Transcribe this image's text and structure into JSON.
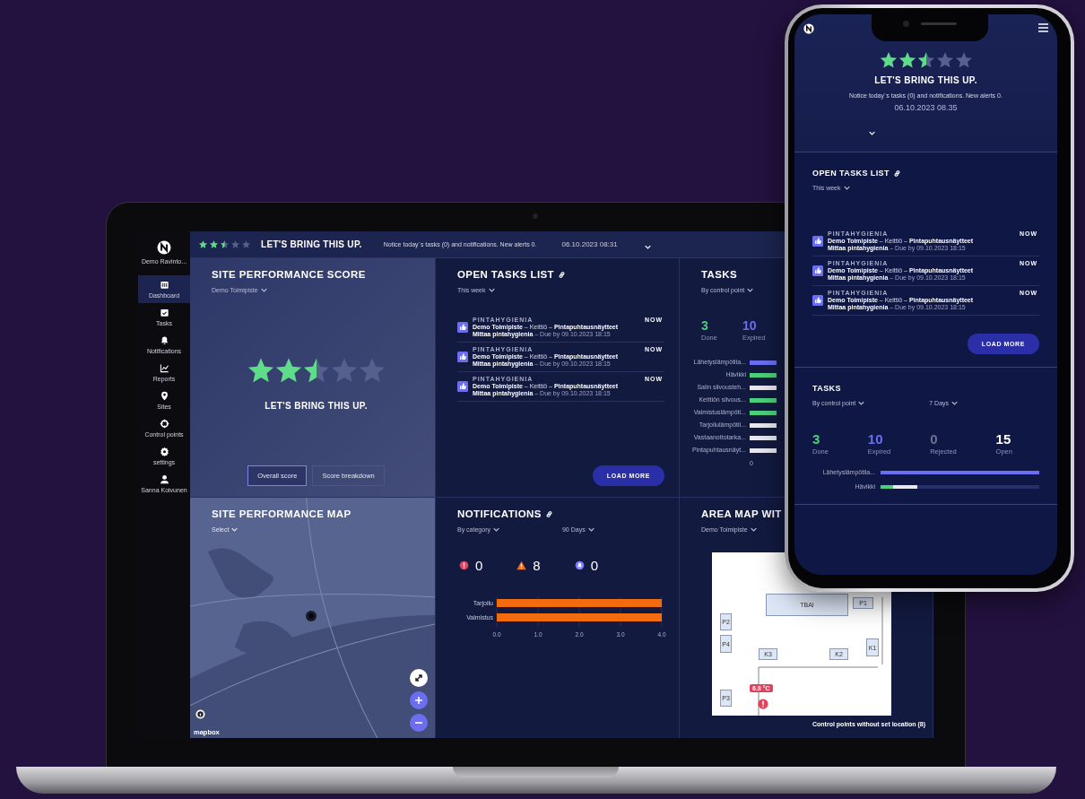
{
  "laptop": {
    "sidebar": {
      "org": "Demo Ravinto...",
      "items": [
        {
          "label": "Dashboard",
          "kind": "calendar",
          "selected": true
        },
        {
          "label": "Tasks",
          "kind": "checklist",
          "selected": false
        },
        {
          "label": "Notifications",
          "kind": "bell",
          "selected": false
        },
        {
          "label": "Reports",
          "kind": "chart",
          "selected": false
        },
        {
          "label": "Sites",
          "kind": "pin",
          "selected": false
        },
        {
          "label": "Control points",
          "kind": "target",
          "selected": false
        },
        {
          "label": "settings",
          "kind": "gear",
          "selected": false
        },
        {
          "label": "Sanna Koivunen",
          "kind": "user",
          "selected": false
        }
      ]
    },
    "top_bar": {
      "stars": 2.5,
      "headline": "LET'S BRING THIS UP.",
      "notice": "Notice today´s tasks (0) and notifications. New alerts 0.",
      "datetime": "06.10.2023 08:31"
    },
    "score_panel": {
      "title": "SITE PERFORMANCE SCORE",
      "filter": "Demo Toimipiste",
      "stars": 2.5,
      "headline": "LET'S BRING THIS UP.",
      "buttons": [
        {
          "label": "Overall score",
          "selected": true
        },
        {
          "label": "Score breakdown",
          "selected": false
        }
      ]
    },
    "open_tasks": {
      "title": "OPEN TASKS LIST",
      "filter": "This week",
      "items": [
        {
          "category": "PINTAHYGIENIA",
          "title": "**Demo Toimipiste** – Keittiö – **Pintapuhtausnäytteet**",
          "due": "**Mittaa pintahygienia** – Due by 09.10.2023 18:15",
          "badge": "NOW"
        },
        {
          "category": "PINTAHYGIENIA",
          "title": "**Demo Toimipiste** – Keittiö – **Pintapuhtausnäytteet**",
          "due": "**Mittaa pintahygienia** – Due by 09.10.2023 18:15",
          "badge": "NOW"
        },
        {
          "category": "PINTAHYGIENIA",
          "title": "**Demo Toimipiste** – Keittiö – **Pintapuhtausnäytteet**",
          "due": "**Mittaa pintahygienia** – Due by 09.10.2023 18:15",
          "badge": "NOW"
        }
      ],
      "load_more": "LOAD MORE"
    },
    "tasks": {
      "title": "TASKS",
      "filter": "By control point",
      "stats": [
        {
          "value": "3",
          "label": "Done",
          "color": "#4cd07d"
        },
        {
          "value": "10",
          "label": "Expired",
          "color": "#6b6ef0"
        }
      ],
      "bars": [
        {
          "label": "Lähetyslämpötila...",
          "color": "#6b6ef0"
        },
        {
          "label": "Hävikki",
          "color": "#4cd07d"
        },
        {
          "label": "Salin siivousteh...",
          "color": "#e8e8f2"
        },
        {
          "label": "Keittiön siivous...",
          "color": "#4cd07d"
        },
        {
          "label": "Valmistuslämpöti...",
          "color": "#4cd07d"
        },
        {
          "label": "Tarjoilulämpötil...",
          "color": "#e8e8f2"
        },
        {
          "label": "Vastaanottotarka...",
          "color": "#e8e8f2"
        },
        {
          "label": "Pintapuhtausnäyt...",
          "color": "#e8e8f2"
        }
      ],
      "axis_tick": "0"
    },
    "map_panel": {
      "title": "SITE PERFORMANCE MAP",
      "filter": "Select",
      "attribution": "mapbox"
    },
    "notifications": {
      "title": "NOTIFICATIONS",
      "filters": [
        "By category",
        "90 Days"
      ],
      "counts": [
        {
          "kind": "error",
          "value": "0"
        },
        {
          "kind": "warning",
          "value": "8"
        },
        {
          "kind": "info",
          "value": "0"
        }
      ],
      "chart_data": {
        "type": "bar",
        "orientation": "horizontal",
        "grid": true,
        "categories": [
          "Tarjoilu",
          "Valmistus"
        ],
        "values": [
          4,
          4
        ],
        "xlim": [
          0,
          4
        ],
        "xticks": [
          {
            "value": 0,
            "label": "0.0"
          },
          {
            "value": 1,
            "label": "1.0"
          },
          {
            "value": 2,
            "label": "2.0"
          },
          {
            "value": 3,
            "label": "3.0"
          },
          {
            "value": 4,
            "label": "4.0"
          }
        ]
      }
    },
    "area_map": {
      "title": "AREA MAP WIT",
      "filter": "Demo Toimipiste",
      "spots": [
        {
          "label": "TBAI"
        },
        {
          "label": "P1"
        },
        {
          "label": "P2"
        },
        {
          "label": "P4"
        },
        {
          "label": "K1"
        },
        {
          "label": "K3"
        },
        {
          "label": "K2"
        },
        {
          "label": "P3"
        }
      ],
      "alert": "6.8 °C",
      "footnote": "Control points without set location (8)"
    }
  },
  "phone": {
    "header": {
      "stars": 2.5,
      "headline": "LET'S BRING THIS UP.",
      "notice": "Notice today´s tasks (0) and notifications. New alerts 0.",
      "datetime": "06.10.2023 08.35"
    },
    "open_tasks": {
      "title": "OPEN TASKS LIST",
      "filter": "This week",
      "items": [
        {
          "category": "PINTAHYGIENIA",
          "title": "**Demo Toimipiste** – Keittiö – **Pintapuhtausnäytteet**",
          "due": "**Mittaa pintahygienia** – Due by 09.10.2023 18:15",
          "badge": "NOW"
        },
        {
          "category": "PINTAHYGIENIA",
          "title": "**Demo Toimipiste** – Keittiö – **Pintapuhtausnäytteet**",
          "due": "**Mittaa pintahygienia** – Due by 09.10.2023 18:15",
          "badge": "NOW"
        },
        {
          "category": "PINTAHYGIENIA",
          "title": "**Demo Toimipiste** – Keittiö – **Pintapuhtausnäytteet**",
          "due": "**Mittaa pintahygienia** – Due by 09.10.2023 18:15",
          "badge": "NOW"
        }
      ],
      "load_more": "LOAD MORE"
    },
    "tasks": {
      "title": "TASKS",
      "filters": [
        "By control point",
        "7 Days"
      ],
      "stats": [
        {
          "value": "3",
          "label": "Done",
          "color": "#4cd07d"
        },
        {
          "value": "10",
          "label": "Expired",
          "color": "#6b6ef0"
        },
        {
          "value": "0",
          "label": "Rejected",
          "color": "#6d7190"
        },
        {
          "value": "15",
          "label": "Open",
          "color": "#ffffff"
        }
      ],
      "bars": [
        {
          "label": "Lähetyslämpötila...",
          "segments": [
            {
              "color": "#6b6ef0",
              "level": 1
            }
          ]
        },
        {
          "label": "Hävikki",
          "segments": [
            {
              "color": "#4cd07d",
              "level": 0.08
            },
            {
              "color": "#e8e8f2",
              "level": 0.15
            }
          ]
        }
      ]
    }
  }
}
